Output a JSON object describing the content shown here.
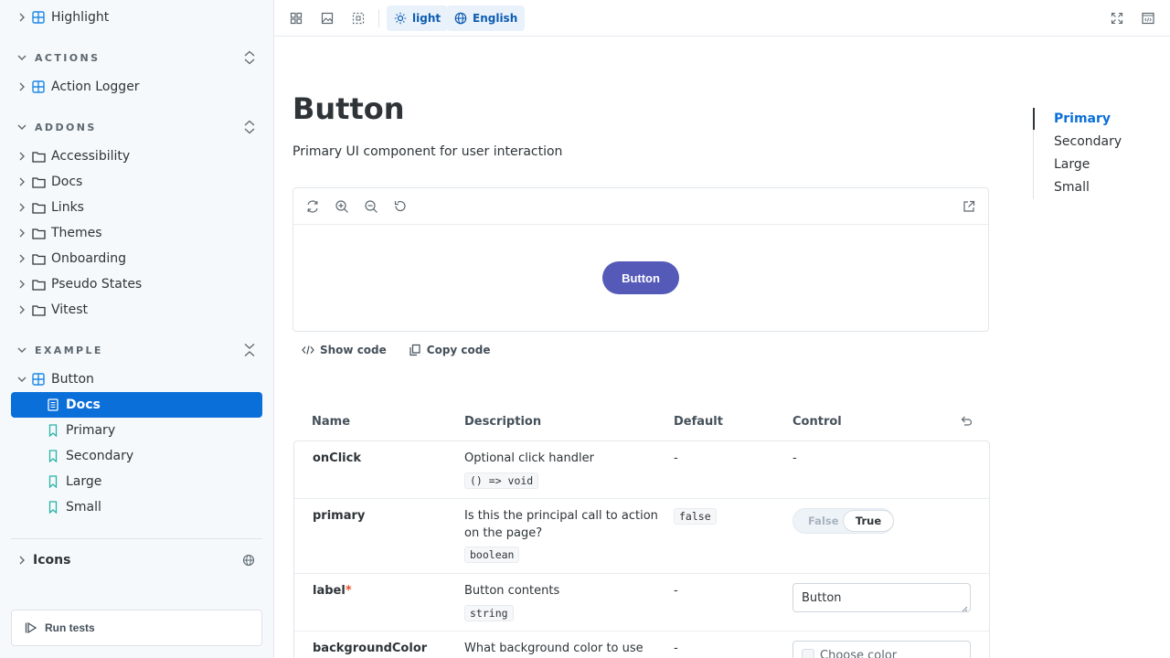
{
  "sidebar": {
    "top_item": {
      "label": "Highlight"
    },
    "sections": [
      {
        "title": "ACTIONS",
        "items": [
          {
            "label": "Action Logger"
          }
        ]
      },
      {
        "title": "ADDONS",
        "items": [
          {
            "label": "Accessibility"
          },
          {
            "label": "Docs"
          },
          {
            "label": "Links"
          },
          {
            "label": "Themes"
          },
          {
            "label": "Onboarding"
          },
          {
            "label": "Pseudo States"
          },
          {
            "label": "Vitest"
          }
        ]
      },
      {
        "title": "EXAMPLE",
        "items": [
          {
            "label": "Button"
          }
        ]
      }
    ],
    "button_children": [
      {
        "label": "Docs",
        "selected": true
      },
      {
        "label": "Primary"
      },
      {
        "label": "Secondary"
      },
      {
        "label": "Large"
      },
      {
        "label": "Small"
      }
    ],
    "icons_label": "Icons",
    "run_tests_label": "Run tests"
  },
  "toolbar": {
    "theme_label": "light",
    "language_label": "English"
  },
  "doc": {
    "title": "Button",
    "description": "Primary UI component for user interaction",
    "demo_button_label": "Button",
    "show_code_label": "Show code",
    "copy_code_label": "Copy code"
  },
  "toc": {
    "items": [
      {
        "label": "Primary",
        "active": true
      },
      {
        "label": "Secondary"
      },
      {
        "label": "Large"
      },
      {
        "label": "Small"
      }
    ]
  },
  "args_table": {
    "headers": {
      "name": "Name",
      "description": "Description",
      "default": "Default",
      "control": "Control"
    },
    "rows": [
      {
        "name": "onClick",
        "description": "Optional click handler",
        "type": "() => void",
        "default": "-",
        "control": "-"
      },
      {
        "name": "primary",
        "description_lines": [
          "Is this the principal call to action",
          "on the page?"
        ],
        "type": "boolean",
        "default": "false",
        "control_false": "False",
        "control_true": "True"
      },
      {
        "name": "label",
        "required_mark": "*",
        "description": "Button contents",
        "type": "string",
        "default": "-",
        "control_value": "Button"
      },
      {
        "name": "backgroundColor",
        "description": "What background color to use",
        "default": "-",
        "control_placeholder": "Choose color"
      }
    ]
  },
  "colors": {
    "accent": "#0b6fd9",
    "sidebar_bg": "#f6f9fc",
    "demo_button": "#555ab9",
    "required": "#e5532d"
  }
}
